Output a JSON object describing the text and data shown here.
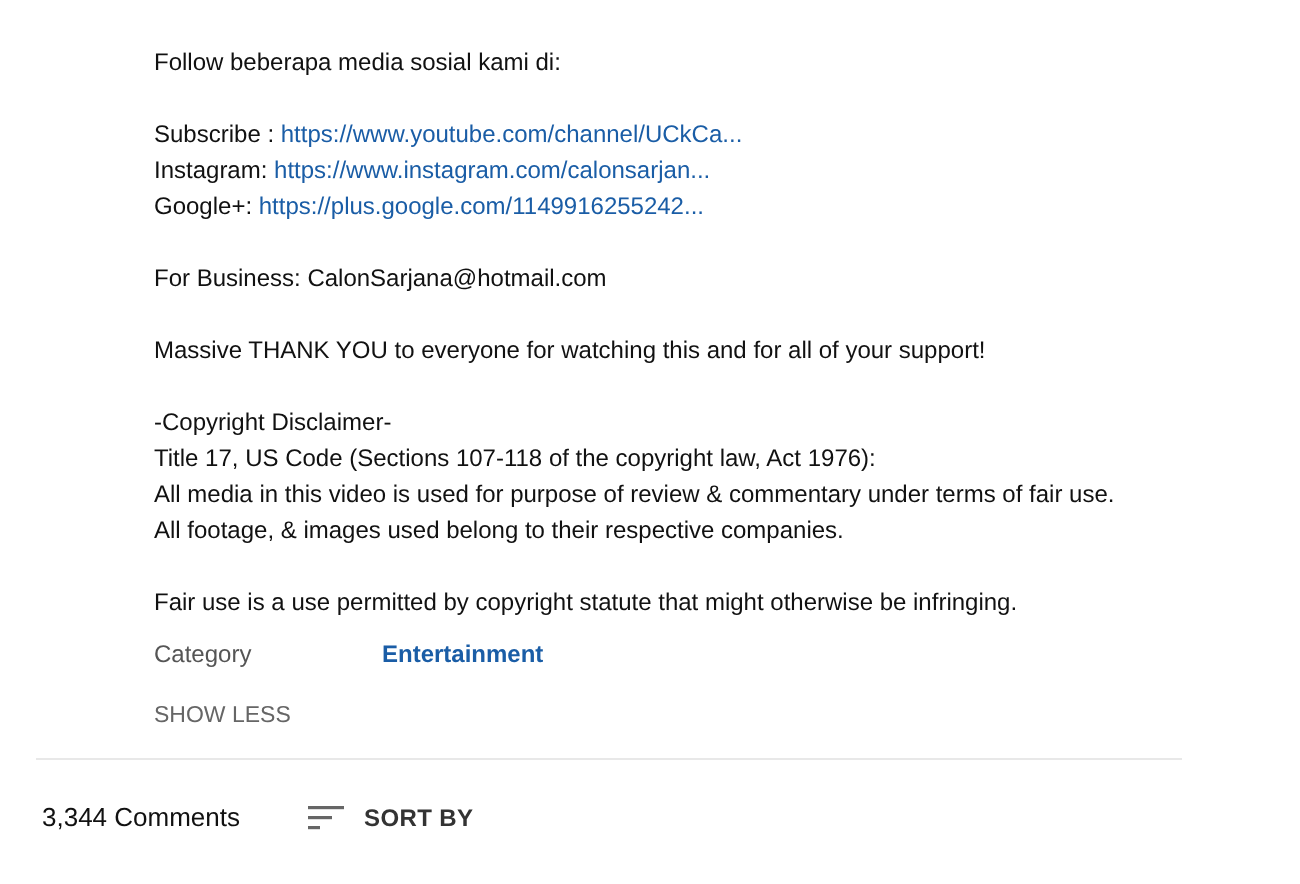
{
  "description": {
    "paragraphs": [
      [
        {
          "text": "Follow beberapa media sosial kami di:"
        }
      ],
      [
        {
          "label": "Subscribe :",
          "link": "https://www.youtube.com/channel/UCkCa..."
        },
        {
          "label": "Instagram:",
          "link": "https://www.instagram.com/calonsarjan..."
        },
        {
          "label": "Google+:",
          "link": "https://plus.google.com/1149916255242..."
        }
      ],
      [
        {
          "text": "For Business: CalonSarjana@hotmail.com"
        }
      ],
      [
        {
          "text": "Massive THANK YOU to everyone for watching this and for all of your support!"
        }
      ],
      [
        {
          "text": "-Copyright Disclaimer-"
        },
        {
          "text": "Title 17, US Code (Sections 107-118 of the copyright law, Act 1976):"
        },
        {
          "text": "All media in this video is used for purpose of review & commentary under terms of fair use."
        },
        {
          "text": "All footage, & images used belong to their respective companies."
        }
      ],
      [
        {
          "text": "Fair use is a use permitted by copyright statute that might otherwise be infringing."
        }
      ]
    ],
    "category": {
      "label": "Category",
      "value": "Entertainment"
    },
    "toggle": "SHOW LESS"
  },
  "comments": {
    "count": "3,344 Comments",
    "sort": "SORT BY"
  }
}
